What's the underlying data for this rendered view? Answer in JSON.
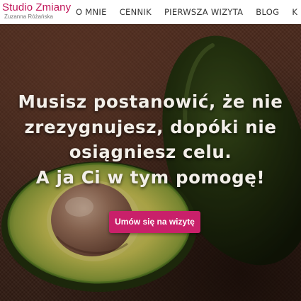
{
  "header": {
    "logo_title": "Studio Zmiany",
    "logo_subtitle": "Zuzanna Różańska",
    "nav": [
      {
        "label": "O MNIE"
      },
      {
        "label": "CENNIK"
      },
      {
        "label": "PIERWSZA WIZYTA"
      },
      {
        "label": "BLOG"
      },
      {
        "label": "K"
      }
    ]
  },
  "hero": {
    "headline_lines": [
      "Musisz postanowić, że nie",
      "zrezygnujesz, dopóki nie",
      "osiągniesz celu.",
      "A ja Ci w tym pomogę!"
    ],
    "cta_label": "Umów się na wizytę"
  },
  "colors": {
    "brand": "#c2185b",
    "cta": "#c9206a",
    "headline_text": "#f3efe9"
  },
  "icons": [
    "avocado-image"
  ]
}
